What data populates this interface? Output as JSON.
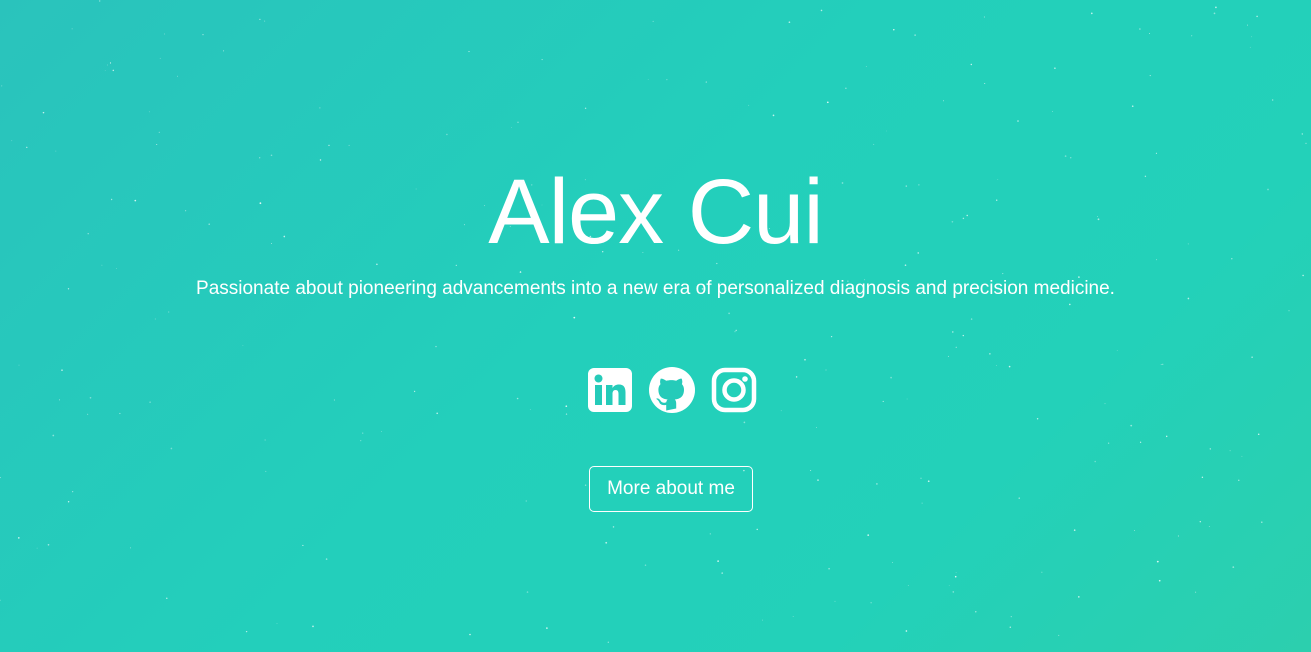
{
  "hero": {
    "name": "Alex Cui",
    "tagline": "Passionate about pioneering advancements into a new era of personalized diagnosis and precision medicine.",
    "more_button_label": "More about me"
  },
  "social_links": [
    {
      "icon": "linkedin-icon"
    },
    {
      "icon": "github-icon"
    },
    {
      "icon": "instagram-icon"
    }
  ],
  "colors": {
    "background_start": "#2ac3bc",
    "background_end": "#2ccfae",
    "foreground": "#ffffff"
  }
}
